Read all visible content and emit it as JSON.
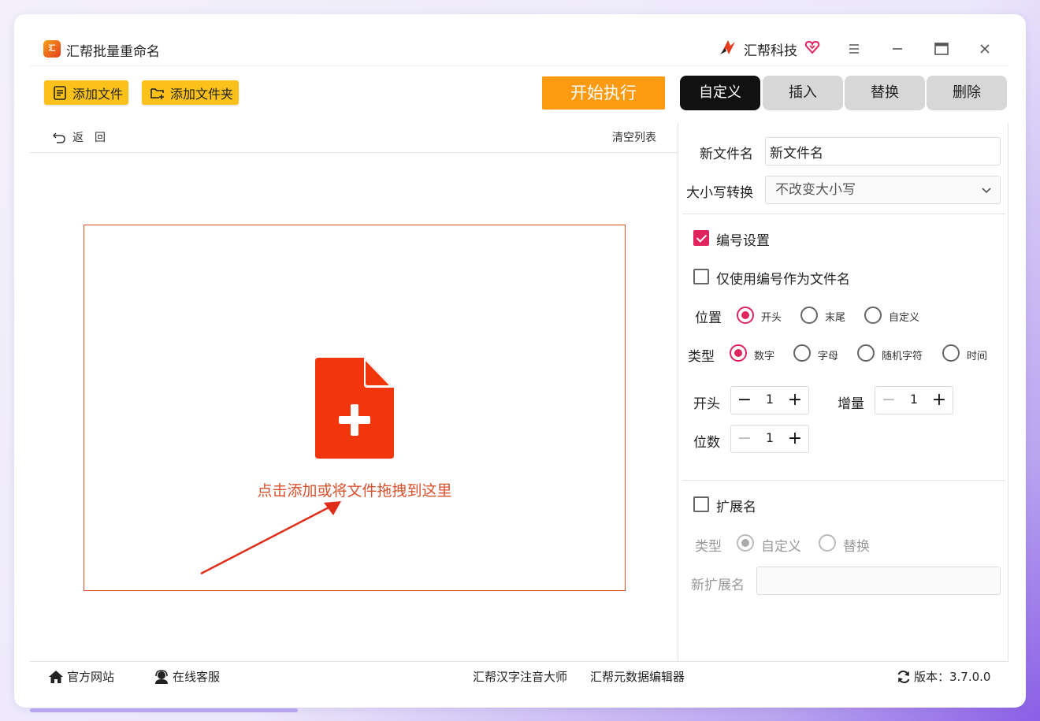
{
  "app": {
    "logo_text": "汇",
    "title": "汇帮批量重命名",
    "brand_name": "汇帮科技"
  },
  "toolbar": {
    "add_file_label": "添加文件",
    "add_folder_label": "添加文件夹",
    "start_label": "开始执行"
  },
  "tabs": [
    {
      "label": "自定义",
      "active": true
    },
    {
      "label": "插入",
      "active": false
    },
    {
      "label": "替换",
      "active": false
    },
    {
      "label": "删除",
      "active": false
    }
  ],
  "list": {
    "back_label": "返回",
    "clear_label": "清空列表",
    "drop_hint": "点击添加或将文件拖拽到这里"
  },
  "panel": {
    "new_name_label": "新文件名",
    "new_name_value": "新文件名",
    "case_label": "大小写转换",
    "case_value": "不改变大小写",
    "numbering": {
      "enabled_label": "编号设置",
      "enabled": true,
      "only_number_label": "仅使用编号作为文件名",
      "only_number": false,
      "position_label": "位置",
      "position_options": [
        "开头",
        "末尾",
        "自定义"
      ],
      "position_selected": "开头",
      "type_label": "类型",
      "type_options": [
        "数字",
        "字母",
        "随机字符",
        "时间"
      ],
      "type_selected": "数字",
      "start_label": "开头",
      "start_value": "1",
      "increment_label": "增量",
      "increment_value": "1",
      "digits_label": "位数",
      "digits_value": "1"
    },
    "extension": {
      "enabled_label": "扩展名",
      "enabled": false,
      "type_label": "类型",
      "type_options": [
        "自定义",
        "替换"
      ],
      "type_selected": "自定义",
      "new_ext_label": "新扩展名",
      "new_ext_value": ""
    }
  },
  "footer": {
    "website_label": "官方网站",
    "support_label": "在线客服",
    "tool1_label": "汇帮汉字注音大师",
    "tool2_label": "汇帮元数据编辑器",
    "version_label": "版本：3.7.0.0"
  },
  "colors": {
    "accent_yellow": "#fcc21b",
    "start_orange": "#fc9a12",
    "drop_red": "#d9502c",
    "check_pink": "#e0245e",
    "tab_active": "#111111"
  }
}
